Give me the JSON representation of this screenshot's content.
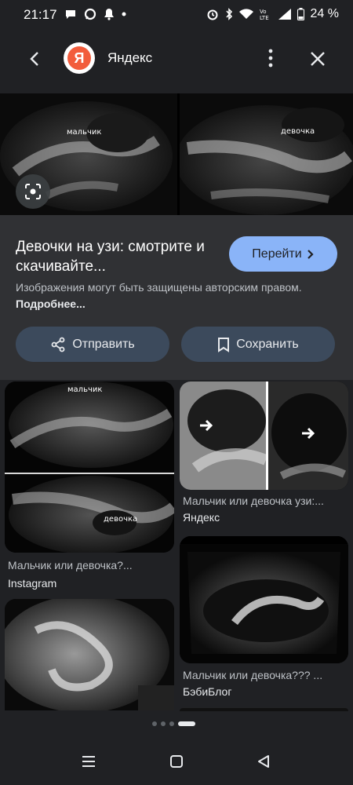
{
  "status_bar": {
    "time": "21:17",
    "battery": "24 %"
  },
  "header": {
    "app_name": "Яндекс",
    "logo_letter": "Я"
  },
  "hero": {
    "left_label": "мальчик",
    "right_label": "девочка"
  },
  "result": {
    "title": "Девочки на узи: смотрите и скачивайте...",
    "go_label": "Перейти",
    "disclaimer": "Изображения могут быть защищены авторским правом.",
    "disclaimer_link": "Подробнее..."
  },
  "actions": {
    "share_label": "Отправить",
    "save_label": "Сохранить"
  },
  "related": [
    {
      "title": "Мальчик или девочка?...",
      "source": "Instagram",
      "labels": [
        "мальчик",
        "девочка"
      ]
    },
    {
      "title": "Мальчик или девочка узи:...",
      "source": "Яндекс"
    },
    {
      "title": "Мальчик или девочка??? ...",
      "source": "БэбиБлог"
    },
    {
      "title": "",
      "source": ""
    }
  ],
  "colors": {
    "background": "#202124",
    "panel": "#303134",
    "accent": "#8ab4f8",
    "button": "#3c4a5c"
  },
  "icons": [
    "back-arrow-icon",
    "more-vert-icon",
    "close-icon",
    "lens-icon",
    "share-icon",
    "bookmark-icon",
    "chevron-right-icon"
  ]
}
